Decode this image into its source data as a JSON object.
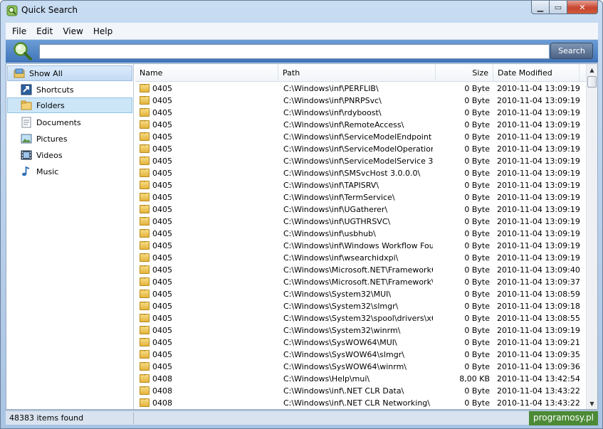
{
  "window": {
    "title": "Quick Search"
  },
  "menu": [
    "File",
    "Edit",
    "View",
    "Help"
  ],
  "search": {
    "value": "",
    "button": "Search"
  },
  "sidebar": [
    {
      "label": "Show All",
      "icon": "show-all-icon"
    },
    {
      "label": "Shortcuts",
      "icon": "shortcut-icon"
    },
    {
      "label": "Folders",
      "icon": "folder-icon"
    },
    {
      "label": "Documents",
      "icon": "document-icon"
    },
    {
      "label": "Pictures",
      "icon": "picture-icon"
    },
    {
      "label": "Videos",
      "icon": "video-icon"
    },
    {
      "label": "Music",
      "icon": "music-icon"
    }
  ],
  "columns": {
    "name": "Name",
    "path": "Path",
    "size": "Size",
    "date": "Date Modified"
  },
  "rows": [
    {
      "name": "0405",
      "path": "C:\\Windows\\inf\\PERFLIB\\",
      "size": "0 Byte",
      "date": "2010-11-04 13:09:19"
    },
    {
      "name": "0405",
      "path": "C:\\Windows\\inf\\PNRPSvc\\",
      "size": "0 Byte",
      "date": "2010-11-04 13:09:19"
    },
    {
      "name": "0405",
      "path": "C:\\Windows\\inf\\rdyboost\\",
      "size": "0 Byte",
      "date": "2010-11-04 13:09:19"
    },
    {
      "name": "0405",
      "path": "C:\\Windows\\inf\\RemoteAccess\\",
      "size": "0 Byte",
      "date": "2010-11-04 13:09:19"
    },
    {
      "name": "0405",
      "path": "C:\\Windows\\inf\\ServiceModelEndpoint 3....",
      "size": "0 Byte",
      "date": "2010-11-04 13:09:19"
    },
    {
      "name": "0405",
      "path": "C:\\Windows\\inf\\ServiceModelOperation ...",
      "size": "0 Byte",
      "date": "2010-11-04 13:09:19"
    },
    {
      "name": "0405",
      "path": "C:\\Windows\\inf\\ServiceModelService 3.0...",
      "size": "0 Byte",
      "date": "2010-11-04 13:09:19"
    },
    {
      "name": "0405",
      "path": "C:\\Windows\\inf\\SMSvcHost 3.0.0.0\\",
      "size": "0 Byte",
      "date": "2010-11-04 13:09:19"
    },
    {
      "name": "0405",
      "path": "C:\\Windows\\inf\\TAPISRV\\",
      "size": "0 Byte",
      "date": "2010-11-04 13:09:19"
    },
    {
      "name": "0405",
      "path": "C:\\Windows\\inf\\TermService\\",
      "size": "0 Byte",
      "date": "2010-11-04 13:09:19"
    },
    {
      "name": "0405",
      "path": "C:\\Windows\\inf\\UGatherer\\",
      "size": "0 Byte",
      "date": "2010-11-04 13:09:19"
    },
    {
      "name": "0405",
      "path": "C:\\Windows\\inf\\UGTHRSVC\\",
      "size": "0 Byte",
      "date": "2010-11-04 13:09:19"
    },
    {
      "name": "0405",
      "path": "C:\\Windows\\inf\\usbhub\\",
      "size": "0 Byte",
      "date": "2010-11-04 13:09:19"
    },
    {
      "name": "0405",
      "path": "C:\\Windows\\inf\\Windows Workflow Foun...",
      "size": "0 Byte",
      "date": "2010-11-04 13:09:19"
    },
    {
      "name": "0405",
      "path": "C:\\Windows\\inf\\wsearchidxpi\\",
      "size": "0 Byte",
      "date": "2010-11-04 13:09:19"
    },
    {
      "name": "0405",
      "path": "C:\\Windows\\Microsoft.NET\\Framework6...",
      "size": "0 Byte",
      "date": "2010-11-04 13:09:40"
    },
    {
      "name": "0405",
      "path": "C:\\Windows\\Microsoft.NET\\Framework\\v...",
      "size": "0 Byte",
      "date": "2010-11-04 13:09:37"
    },
    {
      "name": "0405",
      "path": "C:\\Windows\\System32\\MUI\\",
      "size": "0 Byte",
      "date": "2010-11-04 13:08:59"
    },
    {
      "name": "0405",
      "path": "C:\\Windows\\System32\\slmgr\\",
      "size": "0 Byte",
      "date": "2010-11-04 13:09:18"
    },
    {
      "name": "0405",
      "path": "C:\\Windows\\System32\\spool\\drivers\\x64...",
      "size": "0 Byte",
      "date": "2010-11-04 13:08:55"
    },
    {
      "name": "0405",
      "path": "C:\\Windows\\System32\\winrm\\",
      "size": "0 Byte",
      "date": "2010-11-04 13:09:19"
    },
    {
      "name": "0405",
      "path": "C:\\Windows\\SysWOW64\\MUI\\",
      "size": "0 Byte",
      "date": "2010-11-04 13:09:21"
    },
    {
      "name": "0405",
      "path": "C:\\Windows\\SysWOW64\\slmgr\\",
      "size": "0 Byte",
      "date": "2010-11-04 13:09:35"
    },
    {
      "name": "0405",
      "path": "C:\\Windows\\SysWOW64\\winrm\\",
      "size": "0 Byte",
      "date": "2010-11-04 13:09:36"
    },
    {
      "name": "0408",
      "path": "C:\\Windows\\Help\\mui\\",
      "size": "8,00 KB",
      "date": "2010-11-04 13:42:54"
    },
    {
      "name": "0408",
      "path": "C:\\Windows\\inf\\.NET CLR Data\\",
      "size": "0 Byte",
      "date": "2010-11-04 13:43:22"
    },
    {
      "name": "0408",
      "path": "C:\\Windows\\inf\\.NET CLR Networking\\",
      "size": "0 Byte",
      "date": "2010-11-04 13:43:22"
    }
  ],
  "status": {
    "text": "48383 items found",
    "watermark": "programosy.pl"
  }
}
